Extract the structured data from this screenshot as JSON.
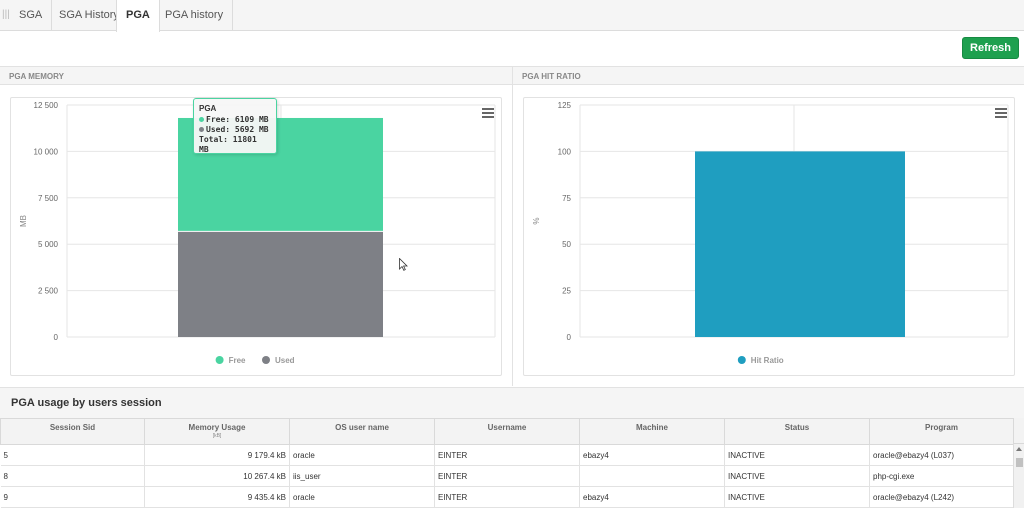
{
  "tabs": [
    {
      "label": "SGA"
    },
    {
      "label": "SGA History"
    },
    {
      "label": "PGA"
    },
    {
      "label": "PGA history"
    }
  ],
  "refresh_label": "Refresh",
  "panels": {
    "memory_title": "PGA MEMORY",
    "hit_title": "PGA HIT RATIO"
  },
  "colors": {
    "free": "#4ad4a1",
    "used": "#7e8086",
    "hit": "#1f9ec0",
    "accent_button": "#1ea04f"
  },
  "tooltip": {
    "title": "PGA",
    "free": "Free: 6109 MB",
    "used": "Used: 5692 MB",
    "total": "Total: 11801 MB"
  },
  "chart_data": [
    {
      "type": "bar",
      "stacked": true,
      "categories": [
        "PGA"
      ],
      "series": [
        {
          "name": "Free",
          "values": [
            6109
          ]
        },
        {
          "name": "Used",
          "values": [
            5692
          ]
        }
      ],
      "ylabel": "MB",
      "ylim": [
        0,
        12500
      ],
      "yticks": [
        "0",
        "2 500",
        "5 000",
        "7 500",
        "10 000",
        "12 500"
      ],
      "legend": "bottom-center",
      "grid": true
    },
    {
      "type": "bar",
      "categories": [
        "Hit Ratio"
      ],
      "series": [
        {
          "name": "Hit Ratio",
          "values": [
            100
          ]
        }
      ],
      "ylabel": "%",
      "ylim": [
        0,
        125
      ],
      "yticks": [
        "0",
        "25",
        "50",
        "75",
        "100",
        "125"
      ],
      "legend": "bottom-center",
      "grid": true
    }
  ],
  "table": {
    "title": "PGA usage by users session",
    "columns": [
      {
        "label": "Session Sid",
        "sub": ""
      },
      {
        "label": "Memory Usage",
        "sub": "[kB]"
      },
      {
        "label": "OS user name",
        "sub": ""
      },
      {
        "label": "Username",
        "sub": ""
      },
      {
        "label": "Machine",
        "sub": ""
      },
      {
        "label": "Status",
        "sub": ""
      },
      {
        "label": "Program",
        "sub": ""
      }
    ],
    "rows": [
      [
        "5",
        "9 179.4 kB",
        "oracle",
        "EINTER",
        "ebazy4",
        "INACTIVE",
        "oracle@ebazy4 (L037)"
      ],
      [
        "8",
        "10 267.4 kB",
        "iis_user",
        "EINTER",
        "",
        "INACTIVE",
        "php-cgi.exe"
      ],
      [
        "9",
        "9 435.4 kB",
        "oracle",
        "EINTER",
        "ebazy4",
        "INACTIVE",
        "oracle@ebazy4 (L242)"
      ]
    ]
  }
}
